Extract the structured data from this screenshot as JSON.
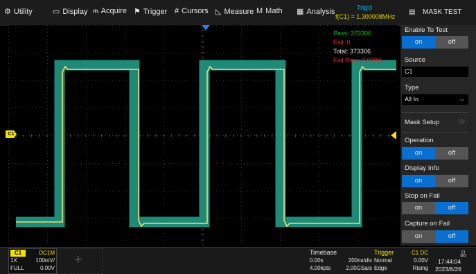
{
  "menu": {
    "items": [
      {
        "icon": "gear-icon",
        "glyph": "⚙",
        "label": "Utility"
      },
      {
        "icon": "display-icon",
        "glyph": "▭",
        "label": "Display"
      },
      {
        "icon": "acquire-icon",
        "glyph": "⫙",
        "label": "Acquire"
      },
      {
        "icon": "flag-icon",
        "glyph": "⚑",
        "label": "Trigger"
      },
      {
        "icon": "cursors-icon",
        "glyph": "#",
        "label": "Cursors"
      },
      {
        "icon": "measure-icon",
        "glyph": "◺",
        "label": "Measure"
      },
      {
        "icon": "math-icon",
        "glyph": "M",
        "label": "Math"
      },
      {
        "icon": "analysis-icon",
        "glyph": "▦",
        "label": "Analysis"
      }
    ],
    "trigger_state": "Trig'd",
    "frequency": "f(C1) = 1.300008MHz"
  },
  "panel": {
    "title": "MASK TEST",
    "enable_to_test": {
      "label": "Enable To Test",
      "on": "on",
      "off": "off",
      "selected": "on"
    },
    "source": {
      "label": "Source",
      "value": "C1"
    },
    "type": {
      "label": "Type",
      "value": "All In"
    },
    "mask_setup": {
      "label": "Mask Setup"
    },
    "operation": {
      "label": "Operation",
      "on": "on",
      "off": "off",
      "selected": "on"
    },
    "display_info": {
      "label": "Display Info",
      "on": "on",
      "off": "off",
      "selected": "on"
    },
    "stop_on_fail": {
      "label": "Stop on Fail",
      "on": "on",
      "off": "off",
      "selected": "off"
    },
    "capture_on_fail": {
      "label": "Capture on Fail",
      "on": "on",
      "off": "off",
      "selected": "off"
    }
  },
  "mask_stats": {
    "pass": "Pass: 373306",
    "fail": "Fail: 0",
    "total": "Total: 373306",
    "fail_rate": "Fail Rate: 0.000%"
  },
  "channel_marker": "C1",
  "channel_info": {
    "name": "C1",
    "coupling": "DC1M",
    "probe": "1X",
    "scale": "100mV/",
    "bandwidth": "FULL",
    "offset": "0.00V"
  },
  "timebase": {
    "label": "Timebase",
    "delay": "0.00s",
    "scale": "200ns/div",
    "points": "4.00kpts",
    "sample_rate": "2.00GSa/s"
  },
  "trigger": {
    "label": "Trigger",
    "source": "C1 DC",
    "mode": "Normal",
    "level": "0.00V",
    "type": "Edge",
    "slope": "Rising"
  },
  "clock": {
    "time": "17:44:04",
    "date": "2023/8/26"
  },
  "colors": {
    "trace": "#e8e070",
    "mask": "#1f8a78",
    "accent": "#0b6fd0",
    "pass": "#19c219",
    "fail": "#e03030",
    "channel": "#f5e000"
  }
}
